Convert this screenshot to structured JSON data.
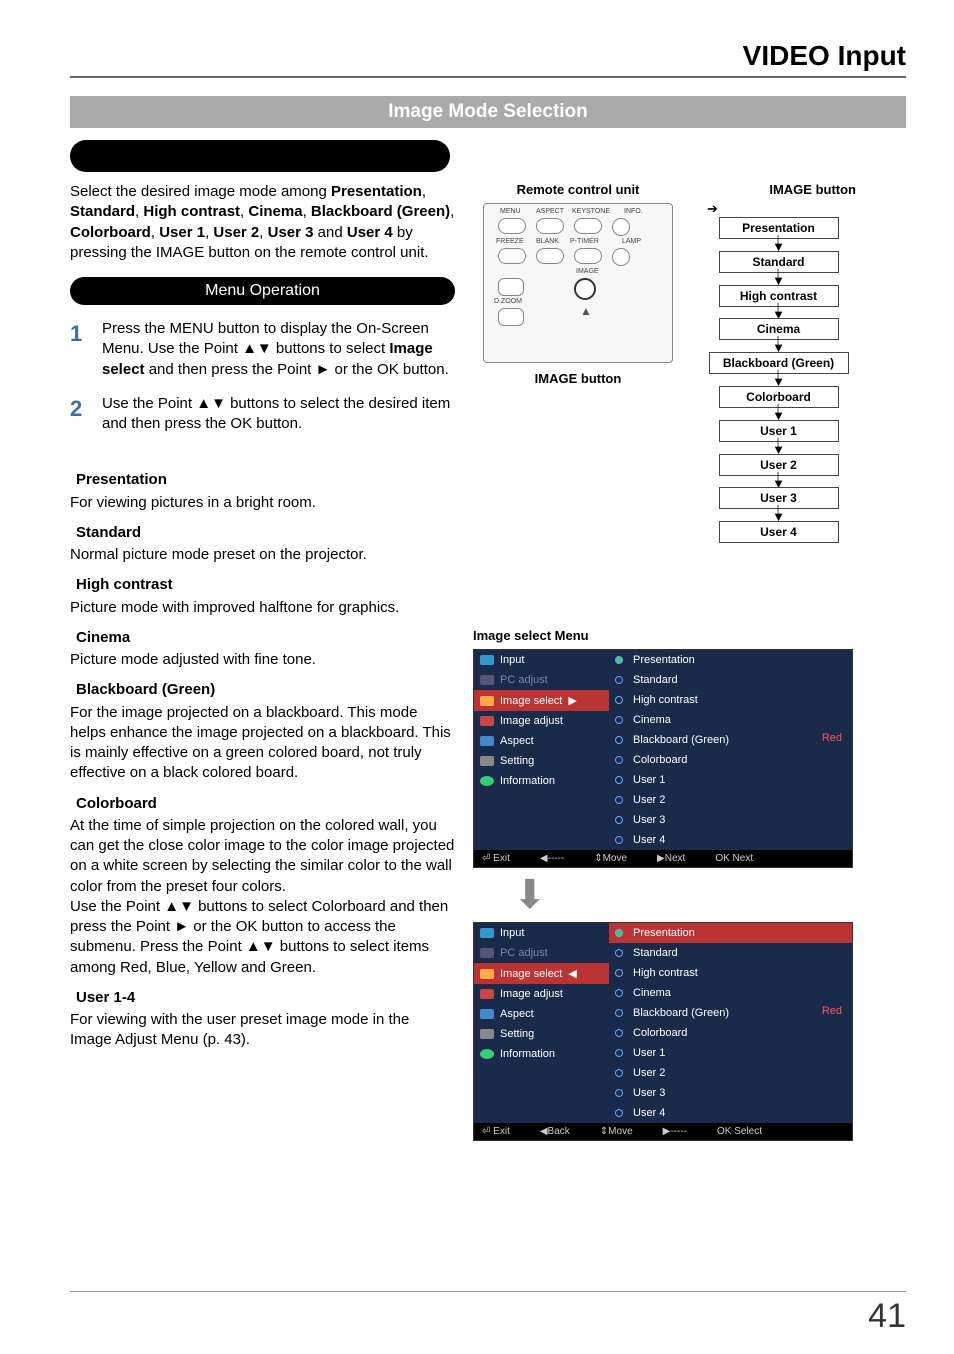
{
  "page": {
    "top_title": "VIDEO Input",
    "section_title": "Image Mode Selection",
    "page_number": "41"
  },
  "intro": {
    "prefix": "Select the desired image mode among ",
    "m1": "Presentation",
    "c1": ", ",
    "m2": "Standard",
    "c2": ", ",
    "m3": "High contrast",
    "c3": ", ",
    "m4": "Cinema",
    "c4": ", ",
    "m5": "Blackboard (Green)",
    "c5": ", ",
    "m6": "Colorboard",
    "c6": ", ",
    "m7": "User 1",
    "c7": ", ",
    "m8": "User 2",
    "c8": ", ",
    "m9": "User 3",
    "c9": " and ",
    "m10": "User 4",
    "suffix": " by pressing the IMAGE button on the remote control unit."
  },
  "menu_op_title": "Menu Operation",
  "steps": {
    "s1": {
      "num": "1",
      "t1": "Press the MENU button to display the On-Screen Menu. Use the Point ▲▼ buttons to select ",
      "b": "Image select",
      "t2": " and then press the Point ► or the OK button."
    },
    "s2": {
      "num": "2",
      "text": "Use the Point ▲▼ buttons to select  the desired item and then press the OK button."
    }
  },
  "modes": {
    "presentation": {
      "h": "Presentation",
      "d": "For viewing pictures in a bright room."
    },
    "standard": {
      "h": "Standard",
      "d": "Normal picture mode preset on the projector."
    },
    "highcontrast": {
      "h": "High contrast",
      "d": "Picture mode with improved halftone for graphics."
    },
    "cinema": {
      "h": "Cinema",
      "d": "Picture mode adjusted with fine tone."
    },
    "blackboard": {
      "h": "Blackboard (Green)",
      "d": "For the image projected on a blackboard. This mode helps enhance the image projected on a blackboard. This is mainly effective on a green colored board, not truly effective on a black colored board."
    },
    "colorboard": {
      "h": "Colorboard",
      "d": "At the time of simple projection on the colored wall, you can get the close color image to the color image projected on a white screen by selecting the similar color to the wall color from the preset four colors.\nUse the Point ▲▼ buttons to select Colorboard and then press the Point ► or the OK button to access the submenu. Press the Point ▲▼ buttons to select items among Red, Blue, Yellow and Green."
    },
    "user": {
      "h": "User 1-4",
      "d": "For viewing with the user preset image mode in the Image Adjust Menu (p. 43)."
    }
  },
  "remote": {
    "title": "Remote control unit",
    "caption": "IMAGE button",
    "labels": {
      "menu": "MENU",
      "aspect": "ASPECT",
      "keystone": "KEYSTONE",
      "info": "INFO.",
      "freeze": "FREEZE",
      "blank": "BLANK",
      "ptimer": "P-TIMER",
      "lamp": "LAMP",
      "image": "IMAGE",
      "dzoom": "D.ZOOM"
    }
  },
  "image_btn": {
    "title": "IMAGE button",
    "items": [
      "Presentation",
      "Standard",
      "High contrast",
      "Cinema",
      "Blackboard (Green)",
      "Colorboard",
      "User 1",
      "User 2",
      "User 3",
      "User 4"
    ]
  },
  "osd": {
    "title": "Image select Menu",
    "left_items": [
      "Input",
      "PC adjust",
      "Image select",
      "Image adjust",
      "Aspect",
      "Setting",
      "Information"
    ],
    "right_items": [
      "Presentation",
      "Standard",
      "High contrast",
      "Cinema",
      "Blackboard (Green)",
      "Colorboard",
      "User 1",
      "User 2",
      "User 3",
      "User 4"
    ],
    "indicator": "Red",
    "footer1": {
      "exit": "Exit",
      "back": "-----",
      "move": "Move",
      "next": "Next",
      "ok": "Next"
    },
    "footer2": {
      "exit": "Exit",
      "back": "Back",
      "move": "Move",
      "next": "-----",
      "ok": "Select"
    }
  }
}
